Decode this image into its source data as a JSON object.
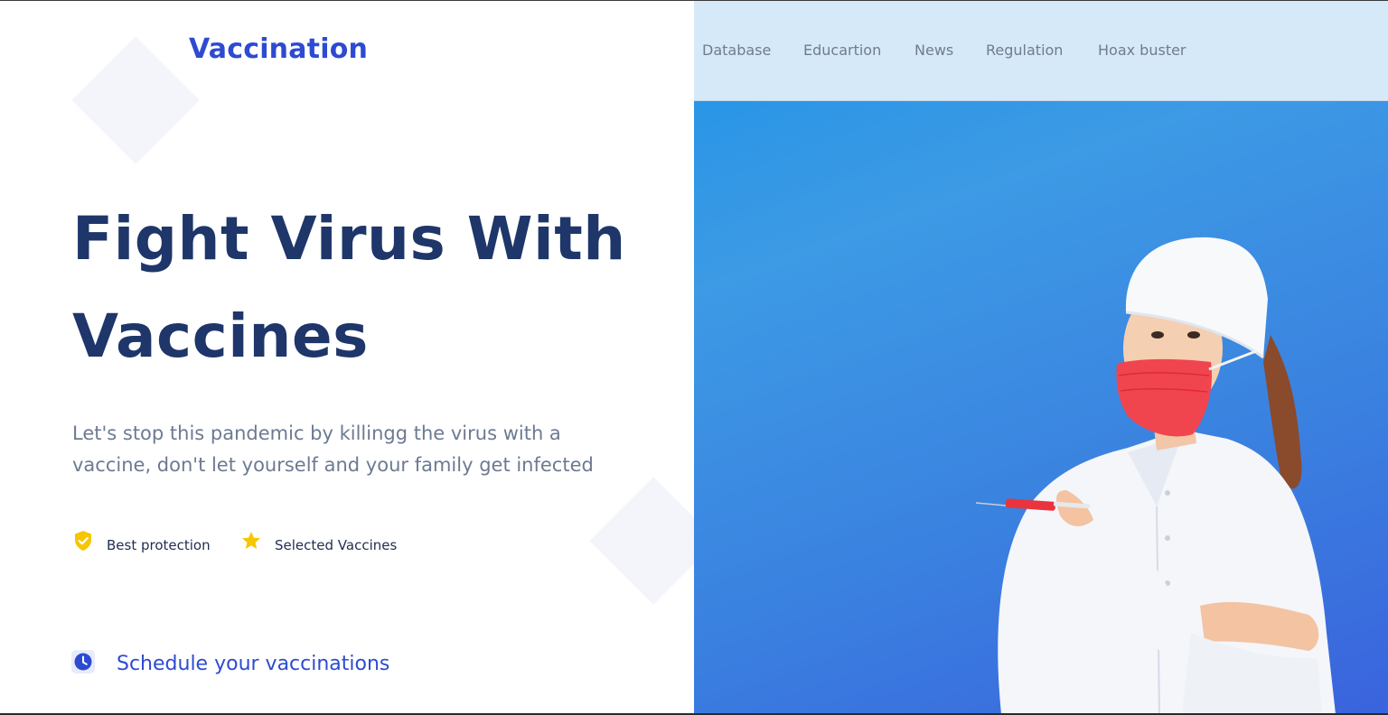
{
  "brand": {
    "name": "Vaccination",
    "color": "#2d4bd1"
  },
  "nav": {
    "items": [
      "Database",
      "Educartion",
      "News",
      "Regulation",
      "Hoax buster"
    ]
  },
  "hero": {
    "title_line1": "Fight Virus With",
    "title_line2": "Vaccines",
    "subtitle_line1": "Let's stop this pandemic by killingg the virus with a",
    "subtitle_line2": "vaccine, don't let yourself and your family get infected",
    "features": [
      {
        "icon": "shield-check-icon",
        "label": "Best protection"
      },
      {
        "icon": "star-icon",
        "label": "Selected Vaccines"
      }
    ],
    "cta": {
      "icon": "clock-icon",
      "label": "Schedule your vaccinations"
    }
  },
  "colors": {
    "heading": "#1e3669",
    "body_text": "#6c7a92",
    "accent_yellow": "#f7c600",
    "nav_background": "#d6e9f8",
    "hero_blue": "#3a82e0"
  },
  "image": {
    "subject": "nurse-holding-syringe"
  }
}
